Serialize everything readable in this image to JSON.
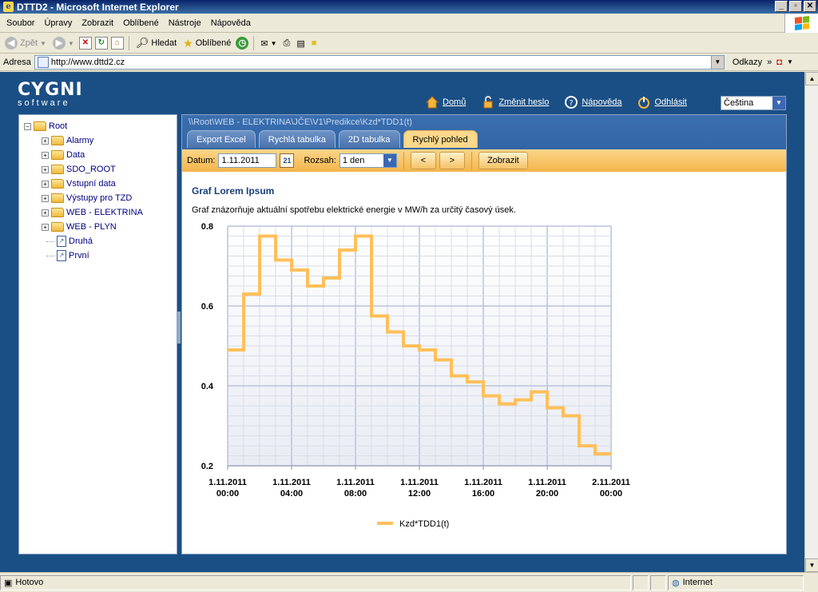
{
  "window": {
    "title": "DTTD2 - Microsoft Internet Explorer"
  },
  "menu": [
    "Soubor",
    "Úpravy",
    "Zobrazit",
    "Oblíbené",
    "Nástroje",
    "Nápověda"
  ],
  "toolbar": {
    "back": "Zpět",
    "search": "Hledat",
    "favorites": "Oblíbené"
  },
  "address": {
    "label": "Adresa",
    "url": "http://www.dttd2.cz",
    "links": "Odkazy"
  },
  "logo": {
    "big": "CYGNI",
    "small": "software"
  },
  "topnav": {
    "home": "Domů",
    "change_password": "Změnit heslo",
    "help": "Nápověda",
    "logout": "Odhlásit",
    "language": "Čeština"
  },
  "tree": {
    "root": "Root",
    "items": [
      "Alarmy",
      "Data",
      "SDO_ROOT",
      "Vstupní data",
      "Výstupy pro TZD",
      "WEB - ELEKTRINA",
      "WEB - PLYN"
    ],
    "docs": [
      "Druhá",
      "První"
    ]
  },
  "panel": {
    "breadcrumb": "\\\\Root\\WEB - ELEKTRINA\\JČE\\V1\\Predikce\\Kzd*TDD1(t)",
    "tabs": [
      "Export Excel",
      "Rychlá tabulka",
      "2D tabulka",
      "Rychlý pohled"
    ],
    "active_tab": "Rychlý pohled",
    "date_label": "Datum:",
    "date_value": "1.11.2011",
    "calendar_day": "21",
    "range_label": "Rozsah:",
    "range_value": "1 den",
    "prev": "<",
    "next": ">",
    "show": "Zobrazit",
    "title": "Graf Lorem Ipsum",
    "description": "Graf znázorňuje aktuální spotřebu elektrické energie v MW/h za určitý časový úsek."
  },
  "chart_data": {
    "type": "line",
    "step": true,
    "title": "",
    "xlabel": "",
    "ylabel": "",
    "ylim": [
      0.2,
      0.8
    ],
    "yticks": [
      0.2,
      0.4,
      0.6,
      0.8
    ],
    "xticks": [
      "1.11.2011\n00:00",
      "1.11.2011\n04:00",
      "1.11.2011\n08:00",
      "1.11.2011\n12:00",
      "1.11.2011\n16:00",
      "1.11.2011\n20:00",
      "2.11.2011\n00:00"
    ],
    "x_hours": [
      0,
      1,
      2,
      3,
      4,
      5,
      6,
      7,
      8,
      9,
      10,
      11,
      12,
      13,
      14,
      15,
      16,
      17,
      18,
      19,
      20,
      21,
      22,
      23
    ],
    "series": [
      {
        "name": "Kzd*TDD1(t)",
        "color": "#ffc05a",
        "values": [
          0.49,
          0.63,
          0.775,
          0.715,
          0.69,
          0.65,
          0.67,
          0.74,
          0.775,
          0.575,
          0.535,
          0.5,
          0.49,
          0.465,
          0.425,
          0.41,
          0.375,
          0.355,
          0.365,
          0.385,
          0.345,
          0.325,
          0.25,
          0.23
        ]
      }
    ],
    "grid": true,
    "legend": "bottom"
  },
  "status": {
    "text": "Hotovo",
    "zone": "Internet"
  }
}
